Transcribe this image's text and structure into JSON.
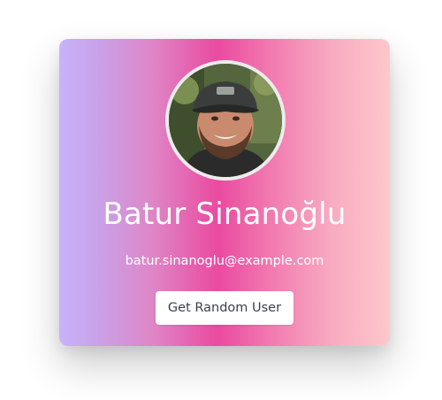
{
  "user": {
    "name": "Batur Sinanoğlu",
    "email": "batur.sinanoglu@example.com"
  },
  "actions": {
    "random_user_label": "Get Random User"
  },
  "colors": {
    "gradient": [
      "#c7b3fb",
      "#ea4aa0",
      "#fdc8cb"
    ],
    "button_bg": "#ffffff",
    "button_text": "#374151",
    "avatar_border": "#ececec"
  },
  "icons": {
    "avatar": "user-photo"
  }
}
